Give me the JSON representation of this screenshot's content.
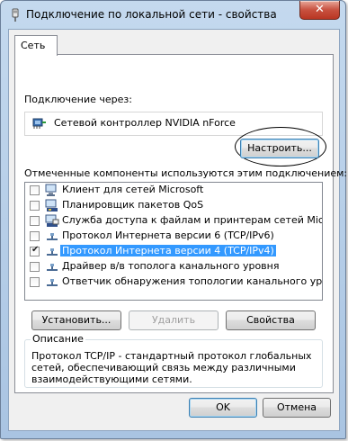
{
  "window": {
    "title": "Подключение по локальной сети - свойства",
    "close_label": "✕"
  },
  "tabs": [
    {
      "label": "Сеть"
    }
  ],
  "connect_using": {
    "label": "Подключение через:",
    "adapter_name": "Сетевой контроллер NVIDIA nForce",
    "configure_label": "Настроить..."
  },
  "components": {
    "label": "Отмеченные компоненты используются этим подключением:",
    "items": [
      {
        "label": "Клиент для сетей Microsoft",
        "checked": false,
        "icon": "client-icon"
      },
      {
        "label": "Планировщик пакетов QoS",
        "checked": false,
        "icon": "qos-icon"
      },
      {
        "label": "Служба доступа к файлам и принтерам сетей Micro...",
        "checked": false,
        "icon": "service-icon"
      },
      {
        "label": "Протокол Интернета версии 6 (TCP/IPv6)",
        "checked": false,
        "icon": "protocol-icon"
      },
      {
        "label": "Протокол Интернета версии 4 (TCP/IPv4)",
        "checked": true,
        "selected": true,
        "icon": "protocol-icon"
      },
      {
        "label": "Драйвер в/в тополога канального уровня",
        "checked": false,
        "icon": "protocol-icon"
      },
      {
        "label": "Ответчик обнаружения топологии канального уровня",
        "checked": false,
        "icon": "protocol-icon"
      }
    ]
  },
  "actions": {
    "install_label": "Установить...",
    "uninstall_label": "Удалить",
    "properties_label": "Свойства"
  },
  "description": {
    "title": "Описание",
    "line1": "Протокол TCP/IP - стандартный протокол глобальных",
    "line2": "сетей, обеспечивающий связь между различными",
    "line3": "взаимодействующими сетями."
  },
  "footer": {
    "ok_label": "OK",
    "cancel_label": "Отмена"
  }
}
